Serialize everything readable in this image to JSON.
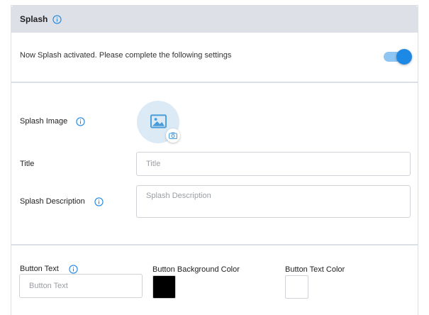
{
  "panel": {
    "title": "Splash",
    "activated_text": "Now Splash activated. Please complete the following settings",
    "toggle_on": true
  },
  "fields": {
    "splash_image_label": "Splash Image",
    "title_label": "Title",
    "title_placeholder": "Title",
    "description_label": "Splash Description",
    "description_placeholder": "Splash Description"
  },
  "button_settings": {
    "button_text_label": "Button Text",
    "button_text_placeholder": "Button Text",
    "bg_color_label": "Button Background Color",
    "bg_color": "#000000",
    "text_color_label": "Button Text Color",
    "text_color": "#ffffff"
  },
  "icons": {
    "info": "info-icon",
    "image": "image-icon",
    "camera": "camera-icon"
  },
  "colors": {
    "accent": "#1e88e5",
    "header_bg": "#dde1e7",
    "toggle_track": "#8ec5f3",
    "uploader_bg": "#dceaf6"
  }
}
